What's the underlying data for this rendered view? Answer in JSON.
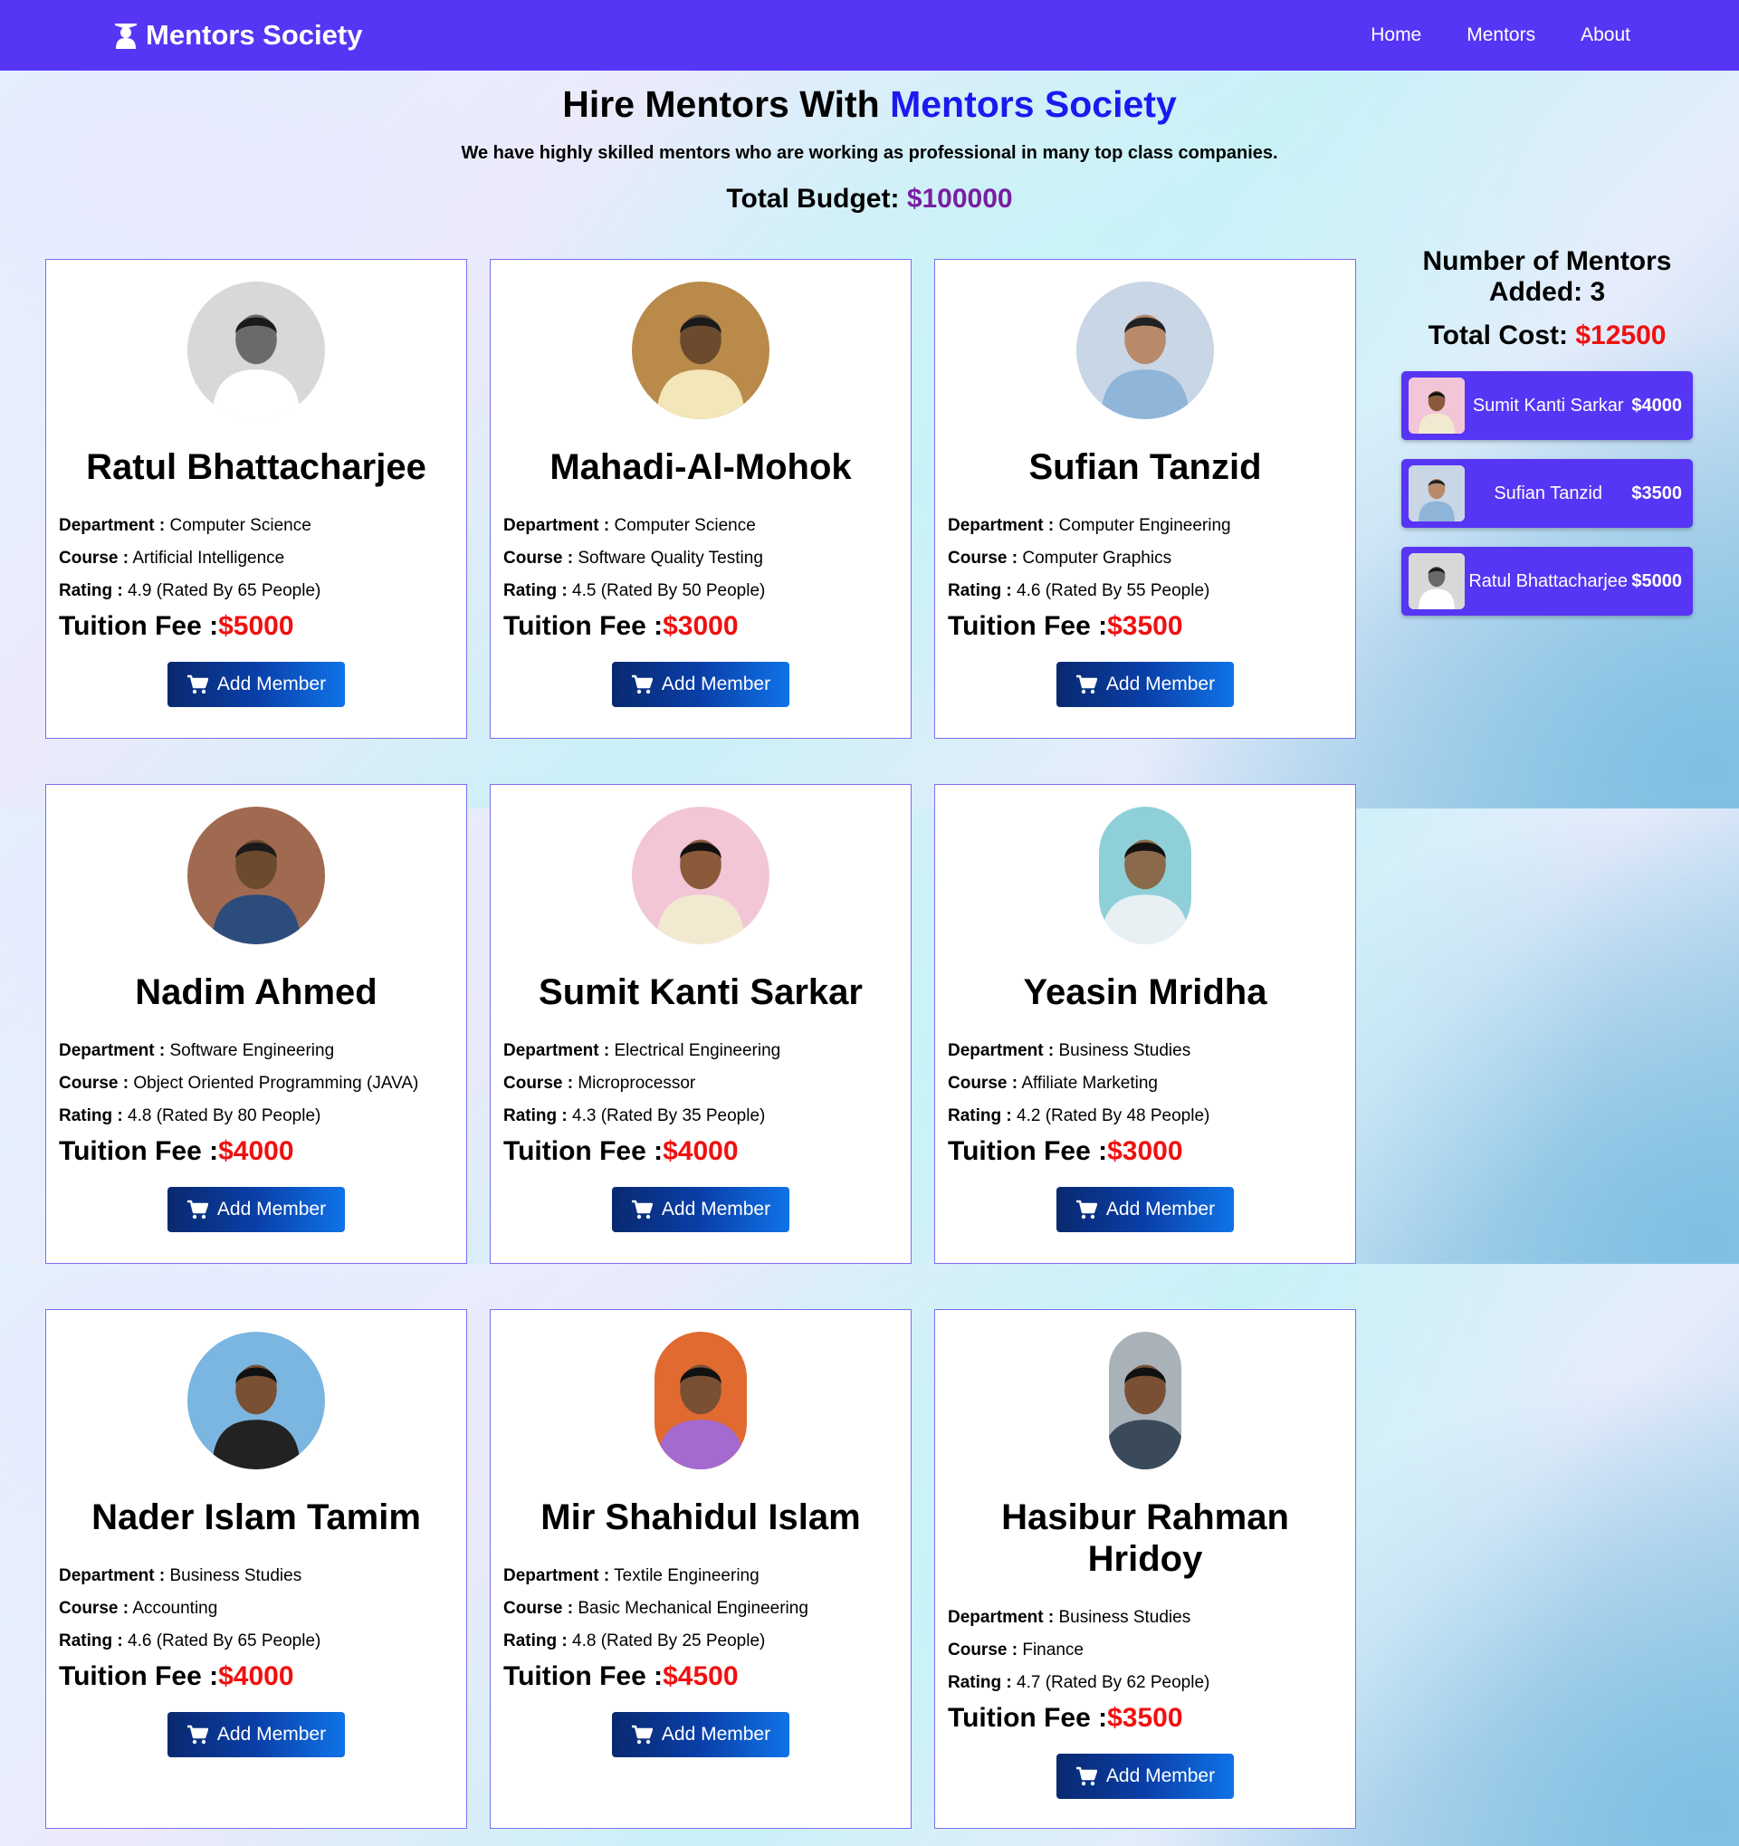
{
  "nav": {
    "brand": "Mentors Society",
    "links": [
      "Home",
      "Mentors",
      "About"
    ]
  },
  "hero": {
    "title_prefix": "Hire Mentors With ",
    "title_accent": "Mentors Society",
    "subtitle": "We have highly skilled mentors who are working as professional in many top class companies.",
    "budget_label": "Total Budget: ",
    "budget_value": "$100000"
  },
  "labels": {
    "department": "Department :",
    "course": "Course :",
    "rating": "Rating :",
    "fee": "Tuition Fee :",
    "add_button": "Add Member"
  },
  "mentors": [
    {
      "name": "Ratul Bhattacharjee",
      "department": "Computer Science",
      "course": "Artificial Intelligence",
      "rating": "4.9 (Rated By 65 People)",
      "fee": "$5000"
    },
    {
      "name": "Mahadi-Al-Mohok",
      "department": "Computer Science",
      "course": "Software Quality Testing",
      "rating": "4.5 (Rated By 50 People)",
      "fee": "$3000"
    },
    {
      "name": "Sufian Tanzid",
      "department": "Computer Engineering",
      "course": "Computer Graphics",
      "rating": "4.6 (Rated By 55 People)",
      "fee": "$3500"
    },
    {
      "name": "Nadim Ahmed",
      "department": "Software Engineering",
      "course": "Object Oriented Programming (JAVA)",
      "rating": "4.8 (Rated By 80 People)",
      "fee": "$4000"
    },
    {
      "name": "Sumit Kanti Sarkar",
      "department": "Electrical Engineering",
      "course": "Microprocessor",
      "rating": "4.3 (Rated By 35 People)",
      "fee": "$4000"
    },
    {
      "name": "Yeasin Mridha",
      "department": "Business Studies",
      "course": "Affiliate Marketing",
      "rating": "4.2 (Rated By 48 People)",
      "fee": "$3000"
    },
    {
      "name": "Nader Islam Tamim",
      "department": "Business Studies",
      "course": "Accounting",
      "rating": "4.6 (Rated By 65 People)",
      "fee": "$4000"
    },
    {
      "name": "Mir Shahidul Islam",
      "department": "Textile Engineering",
      "course": "Basic Mechanical Engineering",
      "rating": "4.8 (Rated By 25 People)",
      "fee": "$4500"
    },
    {
      "name": "Hasibur Rahman Hridoy",
      "department": "Business Studies",
      "course": "Finance",
      "rating": "4.7 (Rated By 62 People)",
      "fee": "$3500"
    }
  ],
  "summary": {
    "count_label": "Number of Mentors Added: 3",
    "cost_label": "Total Cost: ",
    "cost_value": "$12500",
    "selected": [
      {
        "name": "Sumit Kanti Sarkar",
        "price": "$4000"
      },
      {
        "name": "Sufian Tanzid",
        "price": "$3500"
      },
      {
        "name": "Ratul Bhattacharjee",
        "price": "$5000"
      }
    ]
  },
  "colors": {
    "navbar": "#5735f4",
    "accent_blue": "#1a1aee",
    "budget": "#7a1ea0",
    "fee_red": "#f01010",
    "button_start": "#09296f",
    "button_end": "#0f73e8"
  }
}
